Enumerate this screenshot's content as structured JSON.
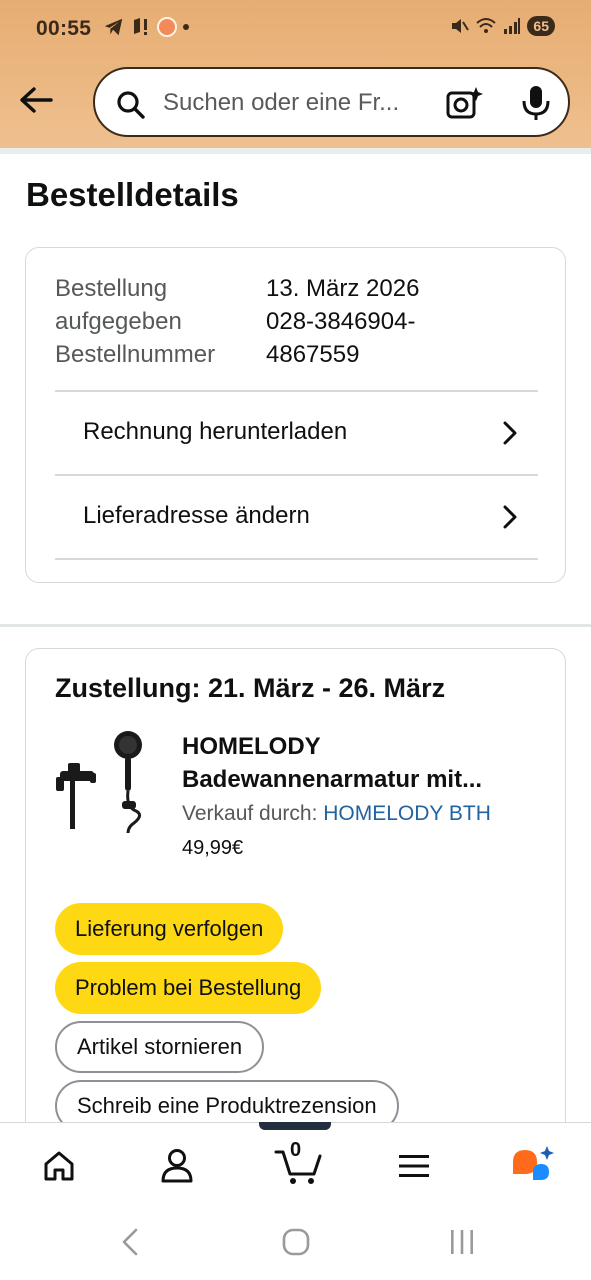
{
  "status_bar": {
    "time": "00:55",
    "battery": "65"
  },
  "search": {
    "placeholder": "Suchen oder eine Fr..."
  },
  "page": {
    "title": "Bestelldetails"
  },
  "order_info": {
    "labels": [
      "Bestellung",
      "aufgegeben",
      "Bestellnummer"
    ],
    "values": [
      "13. März 2026",
      "028-3846904-",
      "4867559"
    ],
    "links": [
      {
        "label": "Rechnung herunterladen"
      },
      {
        "label": "Lieferadresse ändern"
      }
    ]
  },
  "delivery": {
    "heading": "Zustellung: 21. März - 26. März",
    "product": {
      "brand": "HOMELODY",
      "title": "Badewannenarmatur mit...",
      "seller_prefix": "Verkauf durch: ",
      "seller": "HOMELODY BTH",
      "price": "49,99€"
    },
    "actions": [
      {
        "label": "Lieferung verfolgen",
        "style": "yellow"
      },
      {
        "label": "Problem bei Bestellung",
        "style": "yellow"
      },
      {
        "label": "Artikel stornieren",
        "style": "outline"
      },
      {
        "label": "Schreib eine Produktrezension",
        "style": "outline"
      }
    ]
  },
  "bottom_nav": {
    "items": [
      "home-icon",
      "account-icon",
      "cart-icon",
      "menu-icon",
      "rufus-ai-icon"
    ],
    "cart_count": "0"
  },
  "system_nav": {
    "items": [
      "back-icon",
      "home-circle-icon",
      "recents-icon"
    ]
  },
  "colors": {
    "header_bg": "#e6ad72",
    "button_yellow": "#ffd814",
    "link_blue": "#2162a1",
    "rufus_orange": "#ff6b1a",
    "rufus_blue": "#1a8cff"
  }
}
